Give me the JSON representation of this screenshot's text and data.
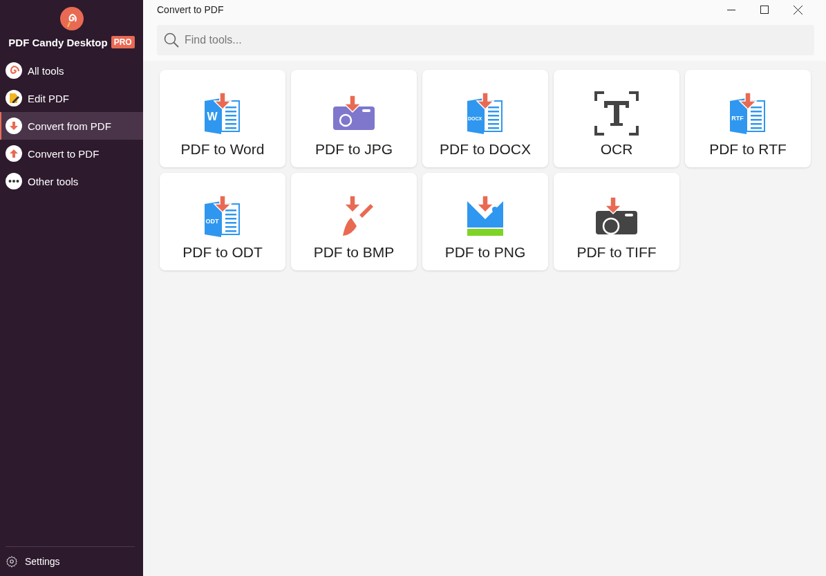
{
  "window": {
    "title": "Convert to PDF"
  },
  "brand": {
    "name": "PDF Candy Desktop",
    "badge": "PRO"
  },
  "sidebar": {
    "items": [
      {
        "label": "All tools",
        "kind": "spiral",
        "selected": false
      },
      {
        "label": "Edit PDF",
        "kind": "edit",
        "selected": false
      },
      {
        "label": "Convert from PDF",
        "kind": "down",
        "selected": true
      },
      {
        "label": "Convert to PDF",
        "kind": "up",
        "selected": false
      },
      {
        "label": "Other tools",
        "kind": "dots",
        "selected": false
      }
    ],
    "footer": {
      "label": "Settings"
    }
  },
  "search": {
    "placeholder": "Find tools..."
  },
  "tools": [
    {
      "label": "PDF to Word",
      "kind": "doc",
      "icon_text": "W"
    },
    {
      "label": "PDF to JPG",
      "kind": "camera"
    },
    {
      "label": "PDF to DOCX",
      "kind": "doc",
      "icon_text": "DOCX"
    },
    {
      "label": "OCR",
      "kind": "ocr"
    },
    {
      "label": "PDF to RTF",
      "kind": "doc",
      "icon_text": "RTF"
    },
    {
      "label": "PDF to ODT",
      "kind": "doc",
      "icon_text": "ODT"
    },
    {
      "label": "PDF to BMP",
      "kind": "brush"
    },
    {
      "label": "PDF to PNG",
      "kind": "image"
    },
    {
      "label": "PDF to TIFF",
      "kind": "camera-dark"
    }
  ]
}
